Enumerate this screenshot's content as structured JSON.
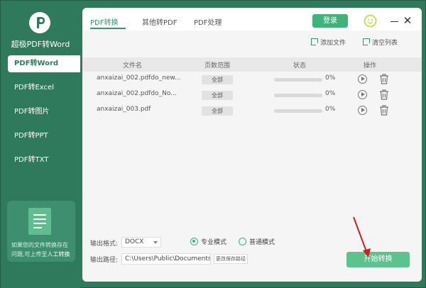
{
  "app": {
    "title": "超极PDF转Word",
    "accent_color": "#2f7a5d",
    "button_color": "#3fb37a"
  },
  "sidebar": {
    "items": [
      {
        "label": "PDF转Word",
        "active": true
      },
      {
        "label": "PDF转Excel",
        "active": false
      },
      {
        "label": "PDF转图片",
        "active": false
      },
      {
        "label": "PDF转PPT",
        "active": false
      },
      {
        "label": "PDF转TXT",
        "active": false
      }
    ],
    "help": {
      "text": "如果您的文件转换存在问题,可上传至",
      "link": "人工转换",
      "icon": "document-icon"
    }
  },
  "header": {
    "tabs": [
      {
        "label": "PDF转换",
        "active": true
      },
      {
        "label": "其他转PDF",
        "active": false
      },
      {
        "label": "PDF处理",
        "active": false
      }
    ],
    "login_label": "登录",
    "icons": [
      "smiley-face-icon",
      "minimize-icon",
      "close-icon"
    ]
  },
  "toolbar": {
    "add_file_label": "添加文件",
    "clear_list_label": "清空列表"
  },
  "table": {
    "columns": [
      "文件名",
      "页数范围",
      "状态",
      "操作"
    ],
    "rows": [
      {
        "filename": "anxaizai_002.pdfdo_new...",
        "range": "全部",
        "progress": 0,
        "percent": "0%"
      },
      {
        "filename": "anxaizai_002.pdfdo_No...",
        "range": "全部",
        "progress": 0,
        "percent": "0%"
      },
      {
        "filename": "anxaizai_003.pdf",
        "range": "全部",
        "progress": 0,
        "percent": "0%"
      }
    ]
  },
  "output": {
    "format_label": "输出格式:",
    "format_value": "DOCX",
    "mode_professional": "专业模式",
    "mode_normal": "普通模式",
    "selected_mode": "专业模式",
    "path_label": "输出路径:",
    "path_value": "C:\\Users\\Public\\Documents\\",
    "change_path_label": "更改保存路径",
    "start_label": "开始转换"
  }
}
